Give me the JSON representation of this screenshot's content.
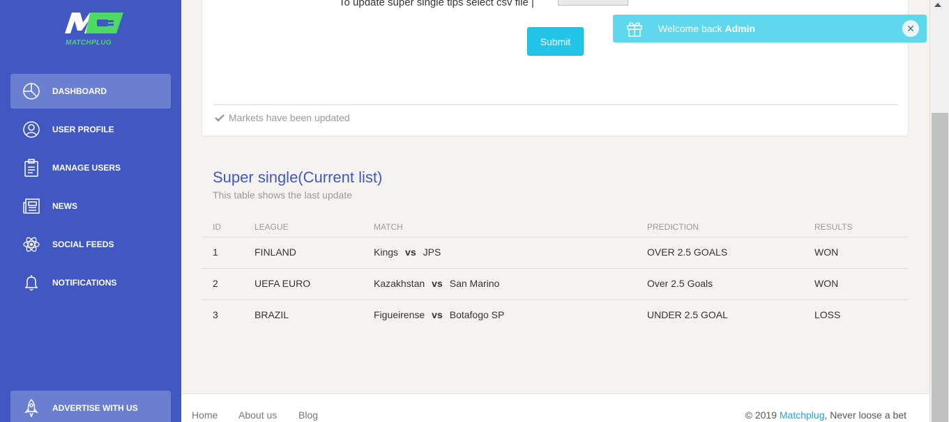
{
  "logo": {
    "text": "MATCHPLUG"
  },
  "sidebar": {
    "items": [
      {
        "label": "DASHBOARD",
        "icon": "pie-chart-icon",
        "active": true
      },
      {
        "label": "USER PROFILE",
        "icon": "user-icon",
        "active": false
      },
      {
        "label": "MANAGE USERS",
        "icon": "clipboard-icon",
        "active": false
      },
      {
        "label": "NEWS",
        "icon": "newspaper-icon",
        "active": false
      },
      {
        "label": "SOCIAL FEEDS",
        "icon": "atom-icon",
        "active": false
      },
      {
        "label": "NOTIFICATIONS",
        "icon": "bell-icon",
        "active": false
      }
    ],
    "advertise": {
      "label": "ADVERTISE WITH US",
      "icon": "rocket-icon"
    }
  },
  "upload": {
    "label": "To update super single tips select csv file |",
    "submit_label": "Submit",
    "status": "Markets have been updated"
  },
  "table_section": {
    "title": "Super single(Current list)",
    "subtitle": "This table shows the last update",
    "headers": [
      "ID",
      "LEAGUE",
      "MATCH",
      "PREDICTION",
      "RESULTS"
    ],
    "vs_label": "vs",
    "rows": [
      {
        "id": "1",
        "league": "FINLAND",
        "home": "Kings",
        "away": "JPS",
        "prediction": "OVER 2.5 GOALS",
        "result": "WON"
      },
      {
        "id": "2",
        "league": "UEFA EURO",
        "home": "Kazakhstan",
        "away": "San Marino",
        "prediction": "Over 2.5 Goals",
        "result": "WON"
      },
      {
        "id": "3",
        "league": "BRAZIL",
        "home": "Figueirense",
        "away": "Botafogo SP",
        "prediction": "UNDER 2.5 GOAL",
        "result": "LOSS"
      }
    ]
  },
  "footer": {
    "links": [
      "Home",
      "About us",
      "Blog"
    ],
    "copyright_prefix": "© 2019 ",
    "brand": "Matchplug",
    "copyright_suffix": ", Never loose a bet"
  },
  "notification": {
    "text": "Welcome back ",
    "user": "Admin",
    "close_symbol": "✕"
  },
  "colors": {
    "sidebar": "#4158c2",
    "accent": "#22c4e8",
    "notification": "#5fd8ee",
    "logo_green": "#4cd964"
  }
}
